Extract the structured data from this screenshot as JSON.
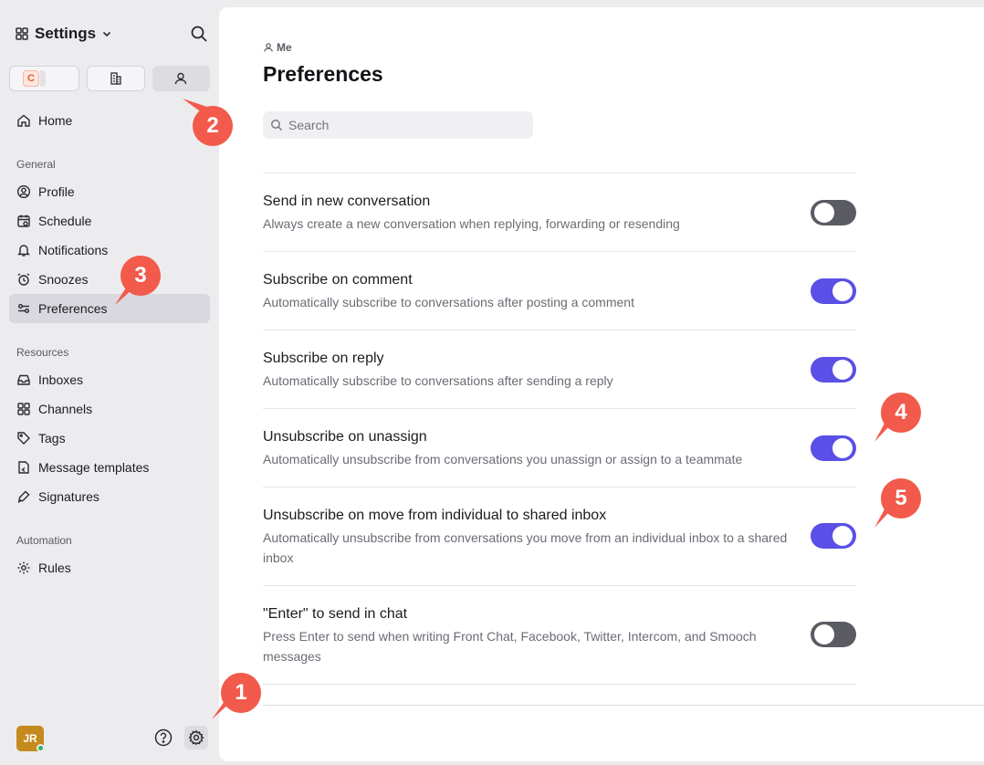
{
  "sidebar": {
    "title": "Settings",
    "company_badge": "C",
    "home": "Home",
    "sections": {
      "general": {
        "label": "General",
        "items": [
          "Profile",
          "Schedule",
          "Notifications",
          "Snoozes",
          "Preferences"
        ]
      },
      "resources": {
        "label": "Resources",
        "items": [
          "Inboxes",
          "Channels",
          "Tags",
          "Message templates",
          "Signatures"
        ]
      },
      "automation": {
        "label": "Automation",
        "items": [
          "Rules"
        ]
      }
    },
    "active_item": "Preferences",
    "user_initials": "JR"
  },
  "main": {
    "breadcrumb": "Me",
    "title": "Preferences",
    "search_placeholder": "Search",
    "settings": [
      {
        "title": "Send in new conversation",
        "desc": "Always create a new conversation when replying, forwarding or resending",
        "on": false
      },
      {
        "title": "Subscribe on comment",
        "desc": "Automatically subscribe to conversations after posting a comment",
        "on": true
      },
      {
        "title": "Subscribe on reply",
        "desc": "Automatically subscribe to conversations after sending a reply",
        "on": true
      },
      {
        "title": "Unsubscribe on unassign",
        "desc": "Automatically unsubscribe from conversations you unassign or assign to a teammate",
        "on": true
      },
      {
        "title": "Unsubscribe on move from individual to shared inbox",
        "desc": "Automatically unsubscribe from conversations you move from an individual inbox to a shared inbox",
        "on": true
      },
      {
        "title": "\"Enter\" to send in chat",
        "desc": "Press Enter to send when writing Front Chat, Facebook, Twitter, Intercom, and Smooch messages",
        "on": false
      }
    ]
  },
  "callouts": [
    "1",
    "2",
    "3",
    "4",
    "5"
  ],
  "colors": {
    "accent": "#5a4fe6",
    "toggle_off": "#5b5b63",
    "callout": "#f25a4b",
    "sidebar_bg": "#ececef"
  }
}
